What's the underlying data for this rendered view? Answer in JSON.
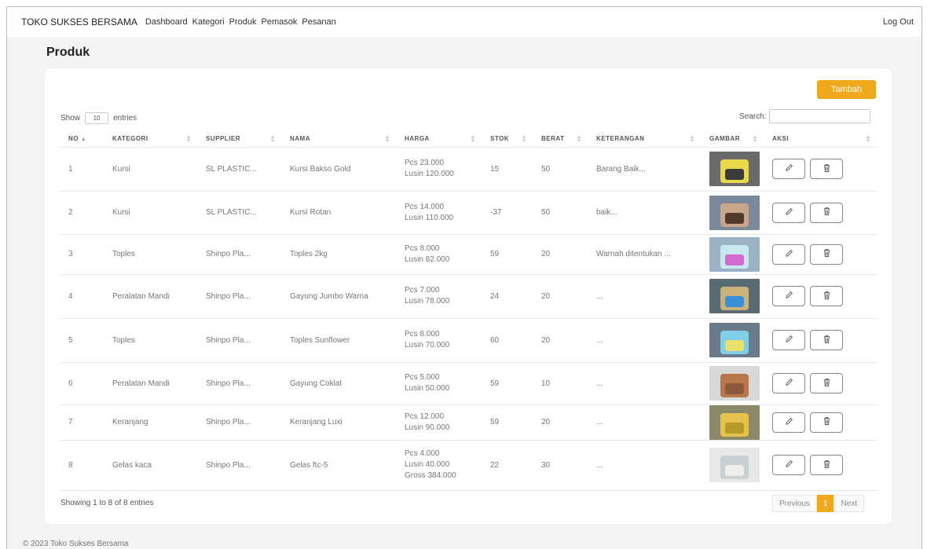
{
  "navbar": {
    "brand": "TOKO SUKSES BERSAMA",
    "links": [
      "Dashboard",
      "Kategori",
      "Produk",
      "Pemasok",
      "Pesanan"
    ],
    "logout": "Log Out"
  },
  "page_title": "Produk",
  "toolbar": {
    "add_label": "Tambah",
    "show_label": "Show",
    "entries_value": "10",
    "entries_label": "entries",
    "search_label": "Search:",
    "search_value": ""
  },
  "table": {
    "headers": [
      "NO",
      "KATEGORI",
      "SUPPLIER",
      "NAMA",
      "HARGA",
      "STOK",
      "BERAT",
      "KETERANGAN",
      "GAMBAR",
      "AKSI"
    ],
    "rows": [
      {
        "no": "1",
        "kategori": "Kursi",
        "supplier": "SL PLASTIC...",
        "nama": "Kursi Bakso Gold",
        "harga": [
          "Pcs 23.000",
          "Lusin 120.000"
        ],
        "stok": "15",
        "berat": "50",
        "keterangan": "Barang Baik..."
      },
      {
        "no": "2",
        "kategori": "Kursi",
        "supplier": "SL PLASTIC...",
        "nama": "Kursi Rotan",
        "harga": [
          "Pcs 14.000",
          "Lusin 110.000"
        ],
        "stok": "-37",
        "berat": "50",
        "keterangan": "baik..."
      },
      {
        "no": "3",
        "kategori": "Toples",
        "supplier": "Shinpo Pla...",
        "nama": "Toples 2kg",
        "harga": [
          "Pcs 8.000",
          "Lusin 82.000"
        ],
        "stok": "59",
        "berat": "20",
        "keterangan": "Warnah ditentukan ..."
      },
      {
        "no": "4",
        "kategori": "Peralatan Mandi",
        "supplier": "Shinpo Pla...",
        "nama": "Gayung Jumbo Warna",
        "harga": [
          "Pcs 7.000",
          "Lusin 78.000"
        ],
        "stok": "24",
        "berat": "20",
        "keterangan": "..."
      },
      {
        "no": "5",
        "kategori": "Toples",
        "supplier": "Shinpo Pla...",
        "nama": "Toples Sunflower",
        "harga": [
          "Pcs 8.000",
          "Lusin 70.000"
        ],
        "stok": "60",
        "berat": "20",
        "keterangan": "..."
      },
      {
        "no": "6",
        "kategori": "Peralatan Mandi",
        "supplier": "Shinpo Pla...",
        "nama": "Gayung Coklat",
        "harga": [
          "Pcs 5.000",
          "Lusin 50.000"
        ],
        "stok": "59",
        "berat": "10",
        "keterangan": "..."
      },
      {
        "no": "7",
        "kategori": "Keranjang",
        "supplier": "Shinpo Pla...",
        "nama": "Keranjang Luxi",
        "harga": [
          "Pcs 12.000",
          "Lusin 90.000"
        ],
        "stok": "59",
        "berat": "20",
        "keterangan": "..."
      },
      {
        "no": "8",
        "kategori": "Gelas kaca",
        "supplier": "Shinpo Pla...",
        "nama": "Gelas ftc-5",
        "harga": [
          "Pcs 4.000",
          "Lusin 40.000",
          "Gross 384.000"
        ],
        "stok": "22",
        "berat": "30",
        "keterangan": "..."
      }
    ]
  },
  "pagination": {
    "showing": "Showing 1 to 8 of 8 entries",
    "previous": "Previous",
    "current": "1",
    "next": "Next"
  },
  "footer": "© 2023 Toko Sukses Bersama",
  "colors": {
    "accent": "#f0a81c",
    "page_bg": "#f3f3f3"
  },
  "icons": {
    "edit": "pencil-icon",
    "delete": "trash-icon",
    "sort": "sort-arrows-icon"
  }
}
